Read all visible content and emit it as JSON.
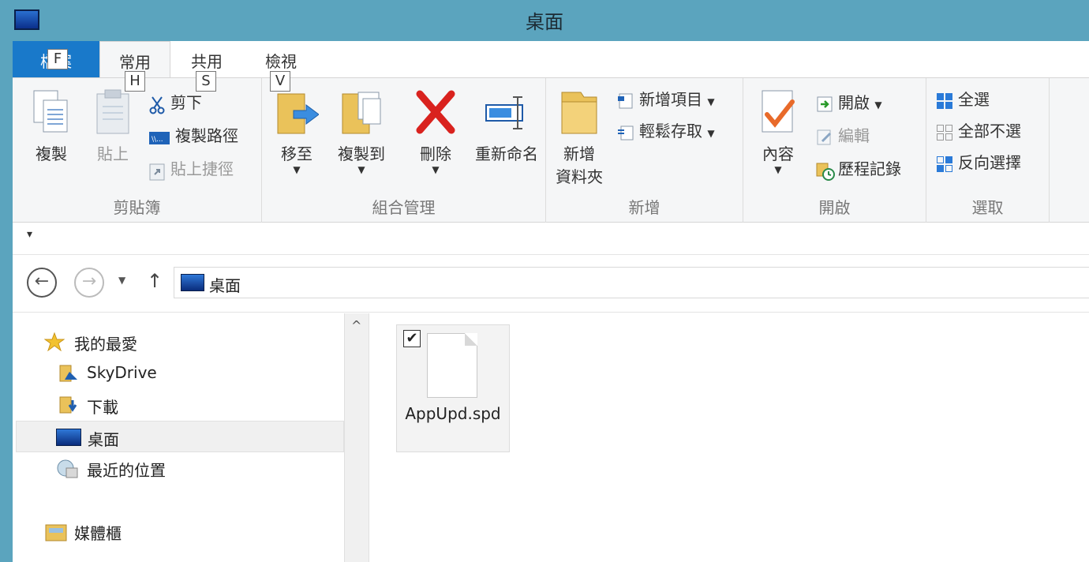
{
  "window": {
    "title": "桌面"
  },
  "tabs": {
    "file": "檔案",
    "home": "常用",
    "share": "共用",
    "view": "檢視"
  },
  "keytips": {
    "file": "F",
    "home": "H",
    "share": "S",
    "view": "V"
  },
  "ribbon": {
    "clipboard": {
      "label": "剪貼簿",
      "copy": "複製",
      "paste": "貼上",
      "cut": "剪下",
      "copy_path": "複製路徑",
      "paste_shortcut": "貼上捷徑"
    },
    "organize": {
      "label": "組合管理",
      "move_to": "移至",
      "copy_to": "複製到",
      "delete": "刪除",
      "rename": "重新命名"
    },
    "new": {
      "label": "新增",
      "new_folder_line1": "新增",
      "new_folder_line2": "資料夾",
      "new_item": "新增項目",
      "easy_access": "輕鬆存取"
    },
    "open": {
      "label": "開啟",
      "properties": "內容",
      "open": "開啟",
      "edit": "編輯",
      "history": "歷程記錄"
    },
    "select": {
      "label": "選取",
      "select_all": "全選",
      "select_none": "全部不選",
      "invert": "反向選擇"
    }
  },
  "address": {
    "path": "桌面"
  },
  "navpane": {
    "favorites": "我的最愛",
    "skydrive": "SkyDrive",
    "downloads": "下載",
    "desktop": "桌面",
    "recent": "最近的位置",
    "libraries": "媒體櫃"
  },
  "content": {
    "file_name": "AppUpd.spd"
  }
}
